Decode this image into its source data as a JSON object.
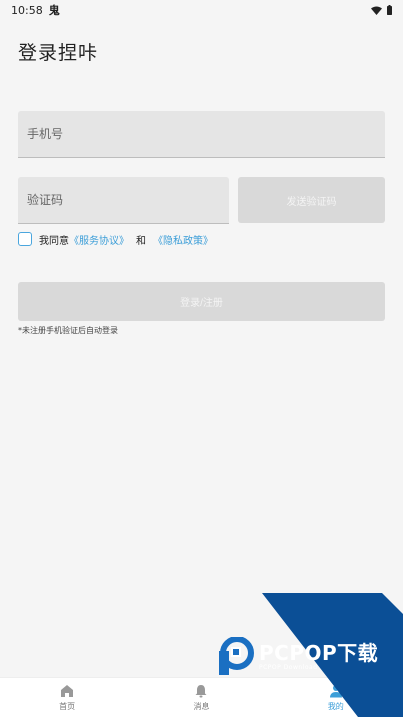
{
  "status_bar": {
    "time": "10:58",
    "notif_glyph": "鬼"
  },
  "page": {
    "title": "登录捏咔"
  },
  "form": {
    "phone_placeholder": "手机号",
    "code_placeholder": "验证码",
    "send_code_label": "发送验证码",
    "agree_prefix": "我同意",
    "terms_link": "《服务协议》",
    "and_text": "和",
    "privacy_link": "《隐私政策》",
    "login_label": "登录/注册",
    "hint": "*未注册手机验证后自动登录"
  },
  "bottom_nav": {
    "items": [
      {
        "label": "首页",
        "icon": "home-icon"
      },
      {
        "label": "消息",
        "icon": "bell-icon"
      },
      {
        "label": "我的",
        "icon": "user-icon"
      }
    ],
    "active_index": 2
  },
  "watermark": {
    "brand": "PCPOP下载",
    "sub": "PCPOP Download"
  },
  "colors": {
    "accent": "#3c9ed8",
    "background": "#f5f5f5",
    "field": "#e5e5e5",
    "disabled_button": "#d9d9d9",
    "watermark_blue": "#0b4f96"
  }
}
